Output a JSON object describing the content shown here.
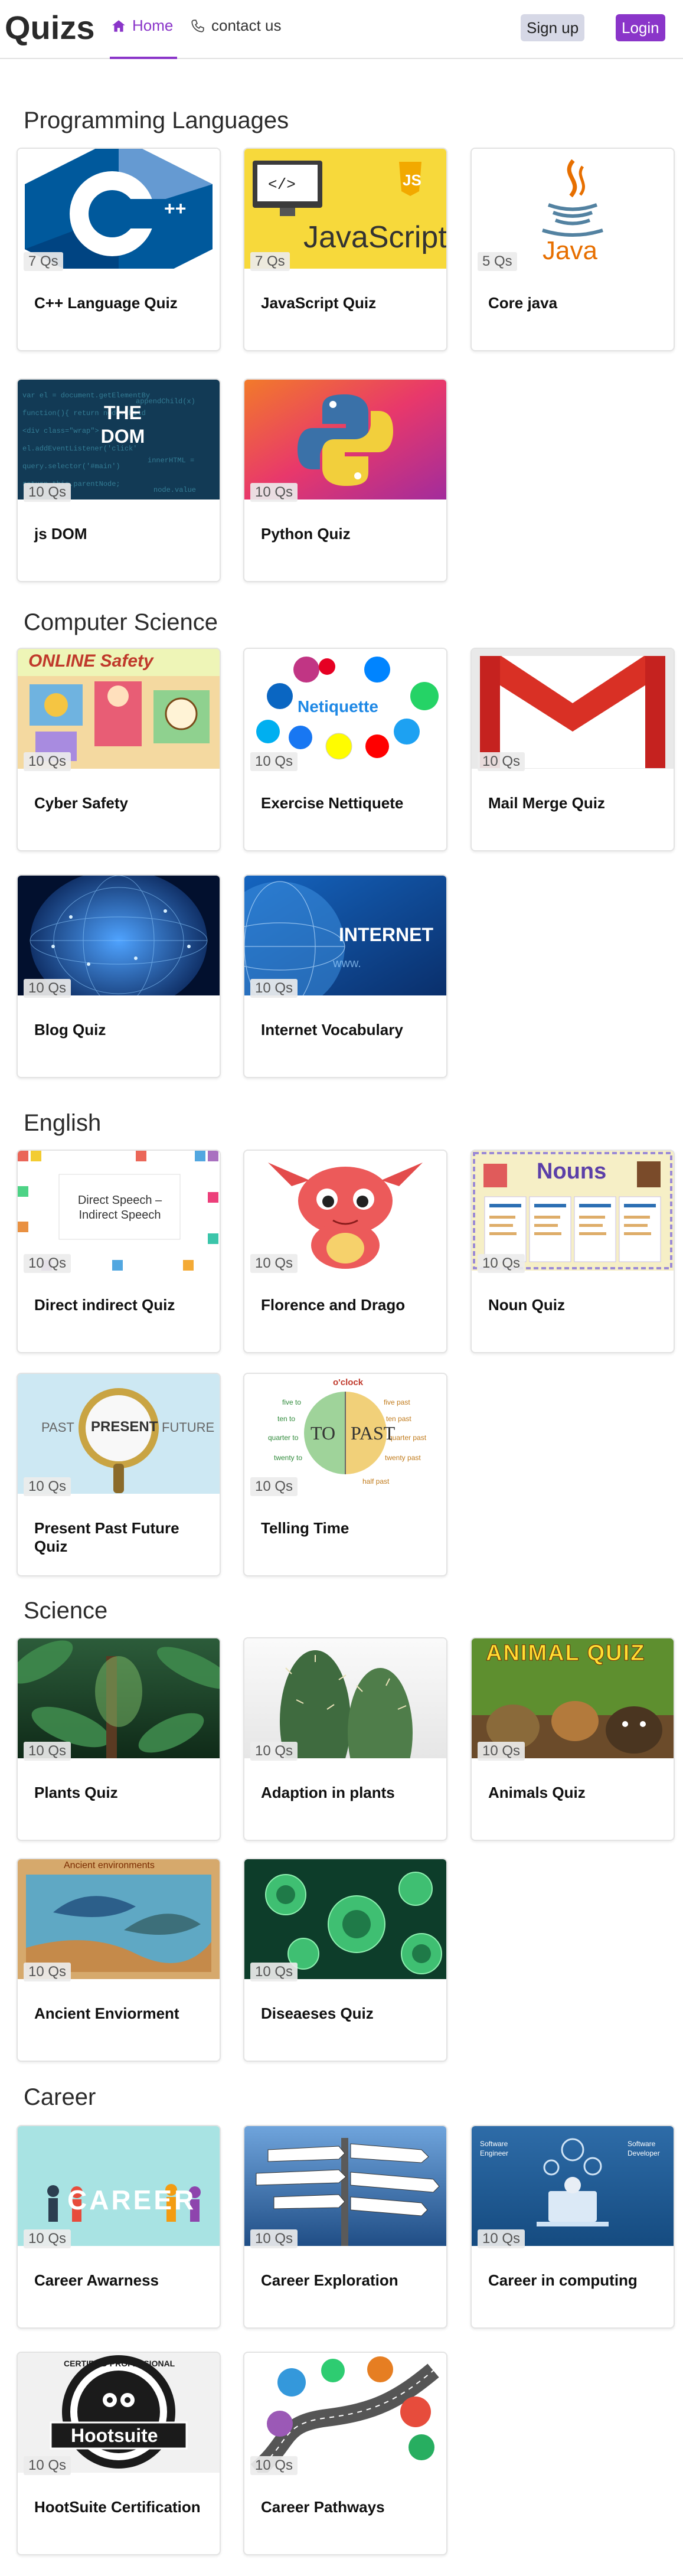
{
  "header": {
    "brand": "Quizs",
    "nav_home": "Home",
    "nav_contact": "contact us",
    "signup": "Sign up",
    "login": "Login",
    "accent": "#8a35c9"
  },
  "sections": [
    {
      "title": "Programming Languages",
      "cards": [
        {
          "title": "C++ Language Quiz",
          "count": "7 Qs",
          "image": "cpp-logo"
        },
        {
          "title": "JavaScript Quiz",
          "count": "7 Qs",
          "image": "javascript-banner",
          "image_text": "JavaScript"
        },
        {
          "title": "Core java",
          "count": "5 Qs",
          "image": "java-logo",
          "image_text": "Java"
        },
        {
          "title": "js DOM",
          "count": "10 Qs",
          "image": "dom-code",
          "image_text": "THE DOM"
        },
        {
          "title": "Python Quiz",
          "count": "10 Qs",
          "image": "python-logo"
        }
      ]
    },
    {
      "title": "Computer Science",
      "cards": [
        {
          "title": "Cyber Safety",
          "count": "10 Qs",
          "image": "online-safety",
          "image_text": "ONLINE Safety"
        },
        {
          "title": "Exercise Nettiquete",
          "count": "10 Qs",
          "image": "netiquette-social",
          "image_text": "Netiquette"
        },
        {
          "title": "Mail Merge Quiz",
          "count": "10 Qs",
          "image": "gmail-logo"
        },
        {
          "title": "Blog Quiz",
          "count": "10 Qs",
          "image": "globe-network"
        },
        {
          "title": "Internet Vocabulary",
          "count": "10 Qs",
          "image": "internet-globe",
          "image_text": "INTERNET"
        }
      ]
    },
    {
      "title": "English",
      "cards": [
        {
          "title": "Direct indirect Quiz",
          "count": "10 Qs",
          "image": "direct-speech",
          "image_text": "Direct Speech – Indirect Speech"
        },
        {
          "title": "Florence and Drago",
          "count": "10 Qs",
          "image": "red-dragon"
        },
        {
          "title": "Noun Quiz",
          "count": "10 Qs",
          "image": "nouns-chart",
          "image_text": "Nouns"
        },
        {
          "title": "Present Past Future Quiz",
          "count": "10 Qs",
          "image": "tense-magnifier",
          "image_text_left": "PAST",
          "image_text_mid": "PRESENT",
          "image_text_right": "FUTURE"
        },
        {
          "title": "Telling Time",
          "count": "10 Qs",
          "image": "clock-to-past",
          "image_text_left": "TO",
          "image_text_right": "PAST",
          "image_text_top": "o'clock"
        }
      ]
    },
    {
      "title": "Science",
      "cards": [
        {
          "title": "Plants Quiz",
          "count": "10 Qs",
          "image": "jungle-plants"
        },
        {
          "title": "Adaption in plants",
          "count": "10 Qs",
          "image": "cactus"
        },
        {
          "title": "Animals Quiz",
          "count": "10 Qs",
          "image": "animals-quiz",
          "image_text": "ANIMAL QUIZ"
        },
        {
          "title": "Ancient Enviorment",
          "count": "10 Qs",
          "image": "ancient-environments",
          "image_text": "Ancient environments"
        },
        {
          "title": "Diseaeses Quiz",
          "count": "10 Qs",
          "image": "green-bacteria"
        }
      ]
    },
    {
      "title": "Career",
      "cards": [
        {
          "title": "Career Awarness",
          "count": "10 Qs",
          "image": "career-people",
          "image_text": "CAREER"
        },
        {
          "title": "Career Exploration",
          "count": "10 Qs",
          "image": "signpost"
        },
        {
          "title": "Career in computing",
          "count": "10 Qs",
          "image": "software-engineer"
        },
        {
          "title": "HootSuite Certification",
          "count": "10 Qs",
          "image": "hootsuite-badge",
          "image_text": "Hootsuite",
          "image_text_arc": "CERTIFIED PROFESSIONAL"
        },
        {
          "title": "Career Pathways",
          "count": "10 Qs",
          "image": "pathway-road"
        }
      ]
    }
  ]
}
